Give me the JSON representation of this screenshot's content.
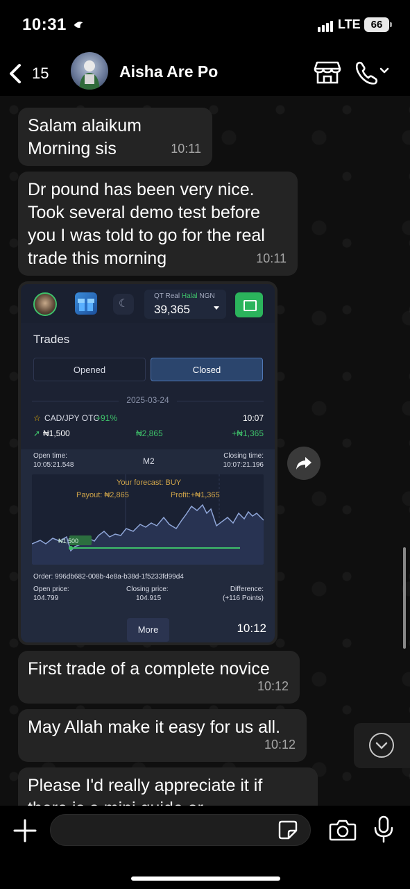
{
  "status_bar": {
    "time": "10:31",
    "network": "LTE",
    "battery": "66"
  },
  "header": {
    "back_count": "15",
    "contact_name": "Aisha Are Po"
  },
  "messages": [
    {
      "text": "Salam alaikum\nMorning sis",
      "time": "10:11"
    },
    {
      "text": "Dr pound has been very nice.\nTook several demo test before\nyou I was told to go for the real\ntrade this morning",
      "time": "10:11"
    },
    {
      "text": "First trade of a complete novice",
      "time": "10:12"
    },
    {
      "text": "May Allah make it easy for us all.",
      "time": "10:12"
    },
    {
      "text": "Please I'd really appreciate it if\nthere is a mini guide or",
      "time": ""
    }
  ],
  "image_message": {
    "time": "10:12",
    "account": {
      "label": "QT Real",
      "tag": "Halal",
      "currency": "NGN",
      "balance": "39,365"
    },
    "trades_title": "Trades",
    "tabs": [
      "Opened",
      "Closed"
    ],
    "active_tab": "Closed",
    "date": "2025-03-24",
    "trade": {
      "pair": "CAD/JPY OTC",
      "percent": "+91%",
      "time": "10:07",
      "amount": "₦1,500",
      "payout": "₦2,865",
      "profit": "+₦1,365",
      "open_time_label": "Open time:",
      "open_time": "10:05:21.548",
      "mode": "M2",
      "close_time_label": "Closing time:",
      "close_time": "10:07:21.196",
      "forecast": "Your forecast: BUY",
      "payout_label": "Payout: ₦2,865",
      "profit_label": "Profit:+₦1,365",
      "marker": "₦1,500",
      "order": "Order: 996db682-008b-4e8a-b38d-1f5233fd99d4",
      "open_price_label": "Open price:",
      "open_price": "104.799",
      "close_price_label": "Closing price:",
      "close_price": "104.915",
      "difference_label": "Difference:",
      "difference": "(+116 Points)"
    },
    "more_button": "More"
  },
  "colors": {
    "bubble": "#242424",
    "app_bg": "#1c2233",
    "accent_green": "#3ec06a",
    "active_tab": "#2b456d"
  }
}
